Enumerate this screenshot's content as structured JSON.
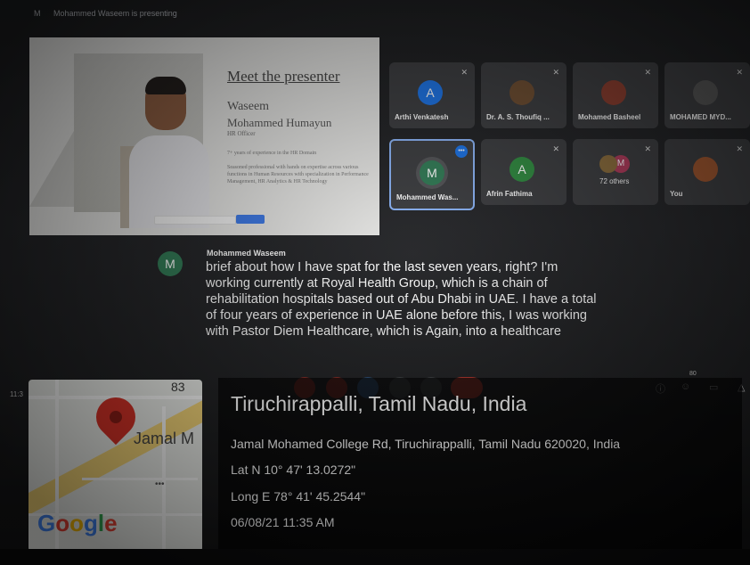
{
  "presenting_banner": {
    "initial": "M",
    "text": "Mohammed Waseem is presenting"
  },
  "slide": {
    "title": "Meet the presenter",
    "name_line1": "Waseem",
    "name_line2": "Mohammed Humayun",
    "role": "HR Officer",
    "bullet1": "7+ years of experience in the HR Domain",
    "bullet2": "Seasoned professional with hands on expertise across various functions in Human Resources with specialization in Performance Management, HR Analytics & HR Technology"
  },
  "participants": [
    {
      "name": "Arthi Venkatesh",
      "initial": "A",
      "color": "#1a73e8",
      "muted": true
    },
    {
      "name": "Dr. A. S. Thoufiq ...",
      "initial": "",
      "color": "#6d4c2f",
      "muted": true
    },
    {
      "name": "Mohamed Basheel",
      "initial": "",
      "color": "#8a3b2c",
      "muted": true
    },
    {
      "name": "MOHAMED MYD...",
      "initial": "",
      "color": "#555",
      "muted": true
    },
    {
      "name": "Mohammed Was...",
      "initial": "M",
      "color": "#2f7a54",
      "speaking": true
    },
    {
      "name": "Afrin Fathima",
      "initial": "A",
      "color": "#2e8b3f",
      "muted": true
    },
    {
      "name": "72 others",
      "initial": "M",
      "color": "#b0395a",
      "muted": true
    },
    {
      "name": "You",
      "initial": "",
      "color": "#a0552d",
      "muted": true
    }
  ],
  "caption": {
    "initial": "M",
    "speaker": "Mohammed Waseem",
    "text": "brief about how I have spat for the last seven years, right? I'm working currently at Royal Health Group, which is a chain of rehabilitation hospitals based out of Abu Dhabi in UAE. I have a total of four years of experience in UAE alone before this, I was working with Pastor Diem Healthcare, which is Again, into a healthcare"
  },
  "controls": {
    "time": "11:3",
    "participants_count": "80",
    "accent_red": "#ea4335"
  },
  "location": {
    "title": "Tiruchirappalli, Tamil Nadu, India",
    "address": "Jamal Mohamed College Rd, Tiruchirappalli, Tamil Nadu 620020, India",
    "lat": "Lat N 10° 47' 13.0272\"",
    "long": "Long E 78° 41' 45.2544\"",
    "datetime": "06/08/21 11:35 AM"
  },
  "map": {
    "road_number": "83",
    "place_label": "Jamal M",
    "brand": "Google"
  }
}
